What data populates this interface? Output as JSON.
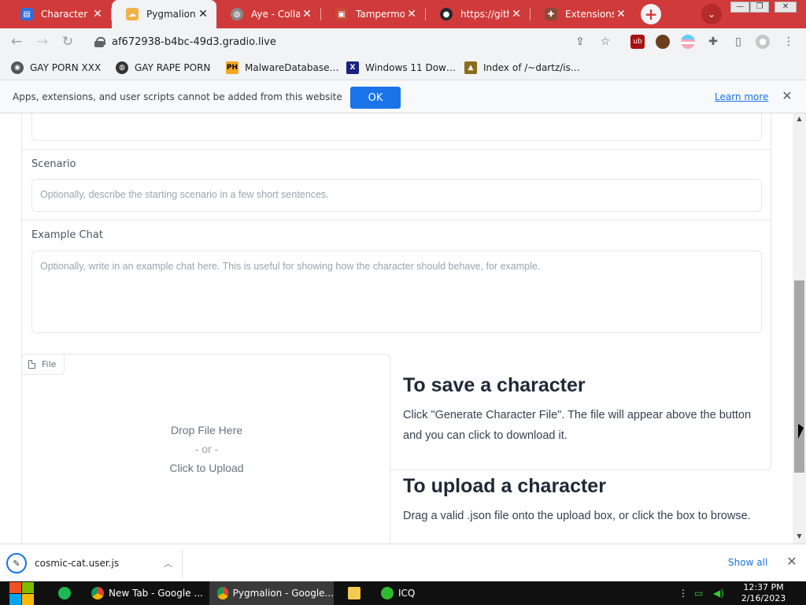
{
  "browser": {
    "tabs": [
      {
        "title": "Character A",
        "favicon_color": "#2f6fdc",
        "active": false
      },
      {
        "title": "Pygmalion",
        "favicon_color": "#f2b24a",
        "active": true
      },
      {
        "title": "Aye - Colla",
        "favicon_color": "#888888",
        "active": false
      },
      {
        "title": "Tampermon",
        "favicon_color": "#c94a3a",
        "active": false
      },
      {
        "title": "https://githu",
        "favicon_color": "#24292f",
        "active": false
      },
      {
        "title": "Extensions",
        "favicon_color": "#8a4a3a",
        "active": false
      }
    ],
    "url": "af672938-b4bc-49d3.gradio.live",
    "window_controls": {
      "minimize": "—",
      "restore": "❐",
      "close": "✕"
    }
  },
  "bookmarks": [
    {
      "label": "GAY PORN XXX",
      "icon_color": "#555555"
    },
    {
      "label": "GAY RAPE PORN",
      "icon_color": "#333333"
    },
    {
      "label": "MalwareDatabase…",
      "icon_color": "#f5a623",
      "icon_text": "PH"
    },
    {
      "label": "Windows 11 Dow…",
      "icon_color": "#1a237e",
      "icon_text": "X"
    },
    {
      "label": "Index of /~dartz/is…",
      "icon_color": "#8a6d1c"
    }
  ],
  "infobar": {
    "message": "Apps, extensions, and user scripts cannot be added from this website",
    "ok_label": "OK",
    "learn_more": "Learn more"
  },
  "form": {
    "scenario_label": "Scenario",
    "scenario_placeholder": "Optionally, describe the starting scenario in a few short sentences.",
    "example_chat_label": "Example Chat",
    "example_chat_placeholder": "Optionally, write in an example chat here. This is useful for showing how the character should behave, for example."
  },
  "upload": {
    "file_tag": "File",
    "drop_text": "Drop File Here",
    "or_text": "- or -",
    "click_text": "Click to Upload"
  },
  "docs": {
    "save_heading": "To save a character",
    "save_text": "Click \"Generate Character File\". The file will appear above the button and you can click to download it.",
    "upload_heading": "To upload a character",
    "upload_text": "Drag a valid .json file onto the upload box, or click the box to browse."
  },
  "downloads": {
    "filename": "cosmic-cat.user.js",
    "show_all": "Show all"
  },
  "taskbar": {
    "tasks": [
      {
        "label": "New Tab - Google ...",
        "active": false
      },
      {
        "label": "Pygmalion - Google...",
        "active": true
      },
      {
        "label": "ICQ",
        "active": false
      }
    ],
    "time": "12:37 PM",
    "date": "2/16/2023"
  },
  "colors": {
    "tabstrip": "#d03a3a",
    "accent_blue": "#1a73e8"
  }
}
